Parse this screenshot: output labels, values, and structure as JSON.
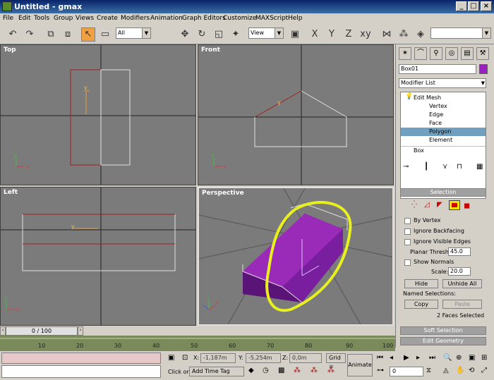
{
  "window": {
    "title": "Untitled - gmax",
    "min": "_",
    "max": "□",
    "close": "×"
  },
  "menu": [
    "File",
    "Edit",
    "Tools",
    "Group",
    "Views",
    "Create",
    "Modifiers",
    "Animation",
    "Graph Editors",
    "Customize",
    "MAXScript",
    "Help"
  ],
  "toolbar": {
    "filter_value": "All",
    "coord_value": "View"
  },
  "viewports": {
    "top": "Top",
    "front": "Front",
    "left": "Left",
    "perspective": "Perspective"
  },
  "panel": {
    "object_name": "Box01",
    "modifier_list": "Modifier List",
    "stack": [
      "Edit Mesh",
      "Vertex",
      "Edge",
      "Face",
      "Polygon",
      "Element",
      "Box"
    ],
    "selection_header": "Selection",
    "by_vertex": "By Vertex",
    "ignore_backfacing": "Ignore Backfacing",
    "ignore_visible_edges": "Ignore Visible Edges",
    "planar_thresh_label": "Planar Thresh:",
    "planar_thresh_value": "45.0",
    "show_normals": "Show Normals",
    "scale_label": "Scale:",
    "scale_value": "20.0",
    "hide": "Hide",
    "unhide_all": "Unhide All",
    "named_selections": "Named Selections:",
    "copy": "Copy",
    "paste": "Paste",
    "faces_selected": "2 Faces Selected",
    "soft_selection": "Soft Selection",
    "edit_geometry": "Edit Geometry"
  },
  "timeline": {
    "frame": "0 / 100",
    "ticks": [
      "10",
      "20",
      "30",
      "40",
      "50",
      "60",
      "70",
      "80",
      "90",
      "100"
    ]
  },
  "status": {
    "x_label": "X:",
    "x_value": "-1,187m",
    "y_label": "Y:",
    "y_value": "-5,254m",
    "z_label": "Z:",
    "z_value": "0,0m",
    "grid_label": "Grid =",
    "animate": "Animate",
    "click_or": "Click or",
    "add_time_tag": "Add Time Tag",
    "frame_value": "0"
  }
}
